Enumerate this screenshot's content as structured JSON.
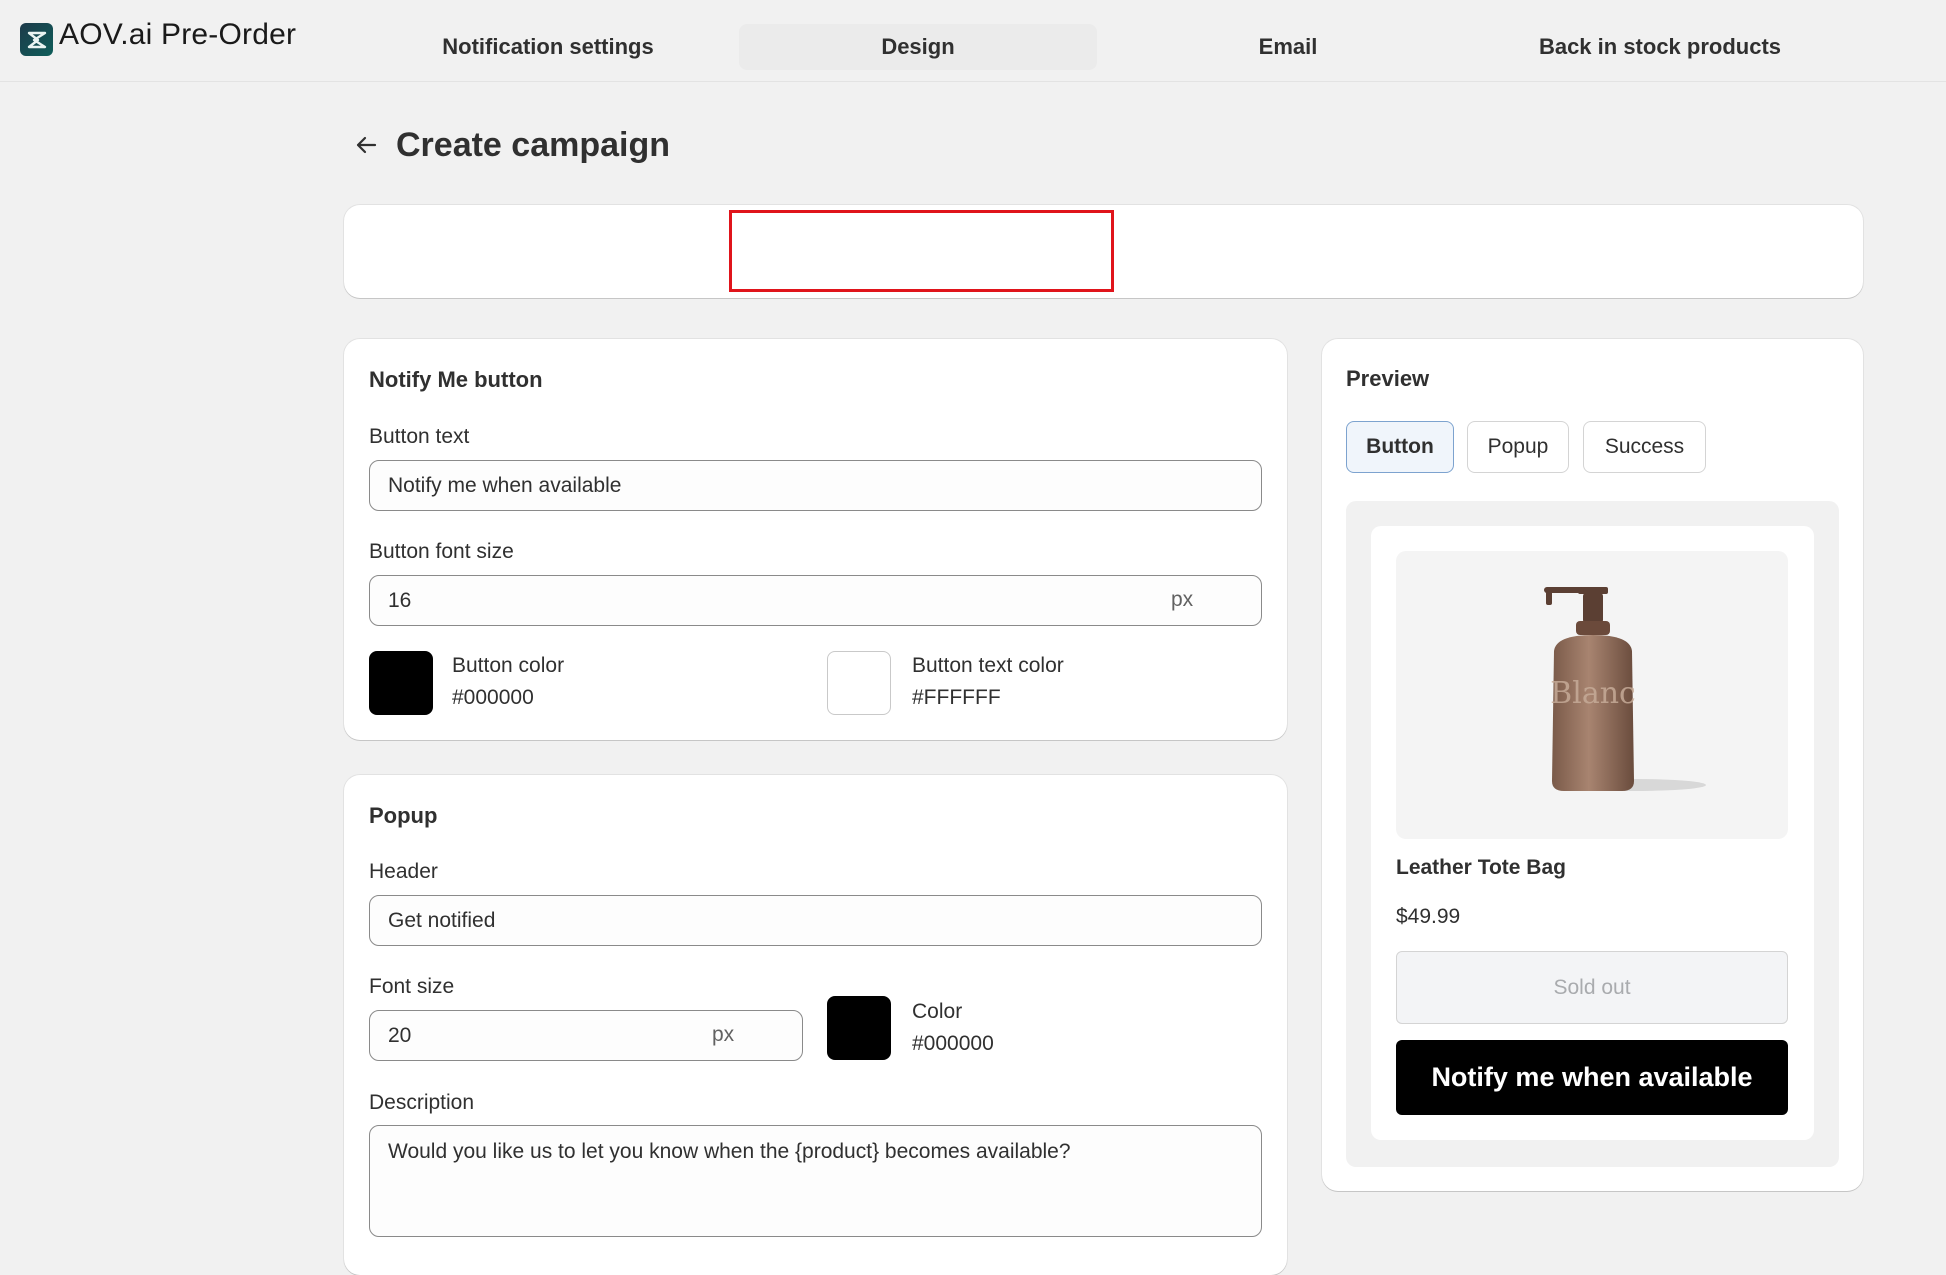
{
  "app": {
    "title": "AOV.ai Pre-Order",
    "logo_icon": "aov-logo-icon"
  },
  "page": {
    "title": "Create campaign",
    "back_icon": "arrow-left-icon"
  },
  "tabs": [
    {
      "label": "Notification settings",
      "active": false
    },
    {
      "label": "Design",
      "active": true
    },
    {
      "label": "Email",
      "active": false
    },
    {
      "label": "Back in stock products",
      "active": false
    }
  ],
  "notify_section": {
    "title": "Notify Me button",
    "button_text_label": "Button text",
    "button_text_value": "Notify me when available",
    "font_size_label": "Button font size",
    "font_size_value": "16",
    "font_size_unit": "px",
    "button_color_label": "Button color",
    "button_color_value": "#000000",
    "button_text_color_label": "Button text color",
    "button_text_color_value": "#FFFFFF"
  },
  "popup_section": {
    "title": "Popup",
    "header_label": "Header",
    "header_value": "Get notified",
    "font_size_label": "Font size",
    "font_size_value": "20",
    "font_size_unit": "px",
    "color_label": "Color",
    "color_value": "#000000",
    "description_label": "Description",
    "description_value": "Would you like us to let you know when the {product} becomes available?"
  },
  "preview": {
    "title": "Preview",
    "modes": [
      {
        "label": "Button",
        "active": true
      },
      {
        "label": "Popup",
        "active": false
      },
      {
        "label": "Success",
        "active": false
      }
    ],
    "product_name": "Leather Tote Bag",
    "product_price": "$49.99",
    "sold_out_label": "Sold out",
    "notify_button_label": "Notify me when available",
    "bottle_text": "Blanc"
  },
  "colors": {
    "accent_highlight": "#e0141b",
    "button_bg": "#000000",
    "button_text": "#FFFFFF"
  }
}
